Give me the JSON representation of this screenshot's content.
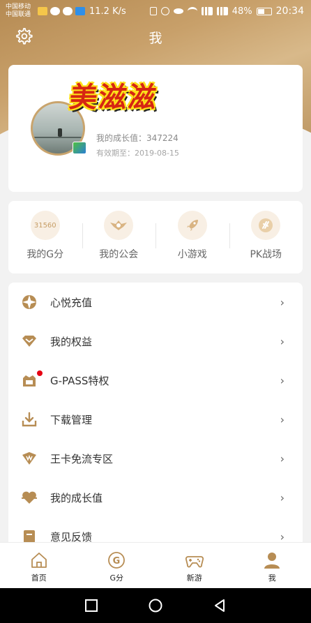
{
  "status_bar": {
    "carrier_1": "中国移动",
    "carrier_2": "中国联通",
    "network_speed": "11.2 K/s",
    "battery": "48%",
    "time": "20:34"
  },
  "header": {
    "title": "我",
    "settings_icon": "gear-icon"
  },
  "profile": {
    "nickname": "美滋滋",
    "growth_value": "我的成长值：347224",
    "expire_date": "有效期至：2019-08-15"
  },
  "quick_links": [
    {
      "label": "我的G分",
      "value": "31560",
      "icon": "g-score"
    },
    {
      "label": "我的公会",
      "icon": "guild-icon"
    },
    {
      "label": "小游戏",
      "icon": "rocket-icon"
    },
    {
      "label": "PK战场",
      "icon": "pk-icon"
    }
  ],
  "menu": [
    {
      "label": "心悦充值",
      "icon": "recharge-icon"
    },
    {
      "label": "我的权益",
      "icon": "rights-icon"
    },
    {
      "label": "G-PASS特权",
      "icon": "gpass-icon",
      "badge": "red-dot"
    },
    {
      "label": "下载管理",
      "icon": "download-icon"
    },
    {
      "label": "王卡免流专区",
      "icon": "king-card-icon"
    },
    {
      "label": "我的成长值",
      "icon": "growth-icon"
    },
    {
      "label": "意见反馈",
      "icon": "feedback-icon"
    }
  ],
  "tabs": [
    {
      "label": "首页",
      "icon": "home-icon"
    },
    {
      "label": "G分",
      "icon": "g-score-icon"
    },
    {
      "label": "新游",
      "icon": "gamepad-icon"
    },
    {
      "label": "我",
      "icon": "person-icon",
      "active": true
    }
  ],
  "colors": {
    "accent": "#c69d65",
    "red_dot": "#e60012"
  }
}
